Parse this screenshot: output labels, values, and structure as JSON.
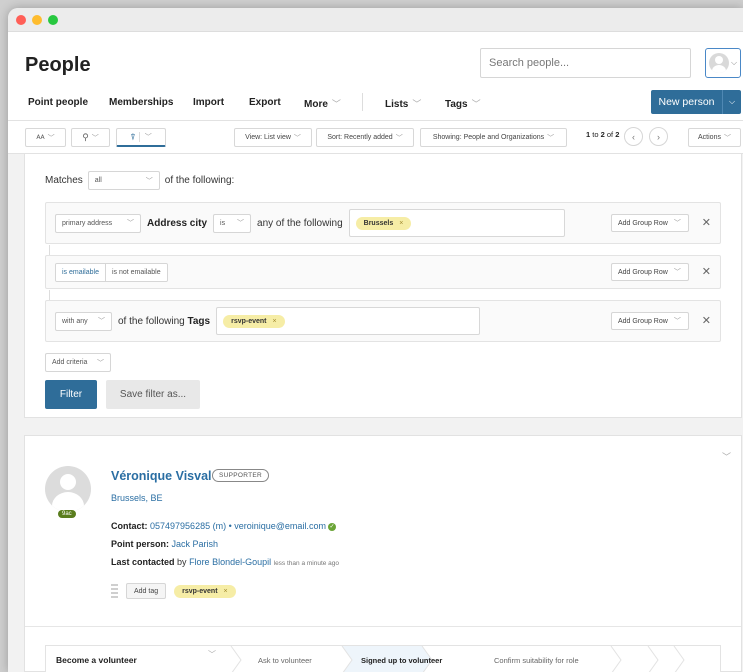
{
  "window": {
    "dots": [
      "#ff5f57",
      "#febc2e",
      "#28c840"
    ]
  },
  "header": {
    "title": "People",
    "search_placeholder": "Search people..."
  },
  "nav": {
    "items": [
      "Point people",
      "Memberships",
      "Import",
      "Export",
      "More",
      "Lists",
      "Tags"
    ],
    "new_person": "New person"
  },
  "toolbar": {
    "view": "View: List view",
    "sort": "Sort: Recently added",
    "showing": "Showing: People and Organizations",
    "pagination_start": "1",
    "pagination_mid": " to ",
    "pagination_end": "2",
    "pagination_of": " of ",
    "pagination_total": "2",
    "actions": "Actions"
  },
  "filter": {
    "matches_prefix": "Matches",
    "matches_value": "all",
    "matches_suffix": "of the following:",
    "row1": {
      "scope": "primary address",
      "field": "Address city",
      "operator": "is",
      "qualifier": "any of the following",
      "tag": "Brussels"
    },
    "row2": {
      "option_on": "is emailable",
      "option_off": "is not emailable"
    },
    "row3": {
      "qualifier": "with any",
      "text_prefix": "of the following",
      "text_bold": "Tags",
      "tag": "rsvp-event"
    },
    "add_group_row": "Add Group Row",
    "add_criteria": "Add criteria",
    "filter_button": "Filter",
    "save_button": "Save filter as..."
  },
  "person": {
    "name": "Véronique Visval",
    "badge": "SUPPORTER",
    "avatar_badge": "9ac",
    "location": "Brussels, BE",
    "contact_label": "Contact:",
    "phone": "057497956285 (m)",
    "separator": "•",
    "email": "veroinique@email.com",
    "point_person_label": "Point person:",
    "point_person": "Jack Parish",
    "last_contacted_label": "Last contacted",
    "last_contacted_by": "by",
    "last_contacted_name": "Flore Blondel-Goupil",
    "last_contacted_time": "less than a minute ago",
    "add_tag": "Add tag",
    "tag": "rsvp-event"
  },
  "steps": {
    "title": "Become a volunteer",
    "items": [
      "Ask to volunteer",
      "Signed up to volunteer",
      "Confirm suitability for role"
    ]
  }
}
